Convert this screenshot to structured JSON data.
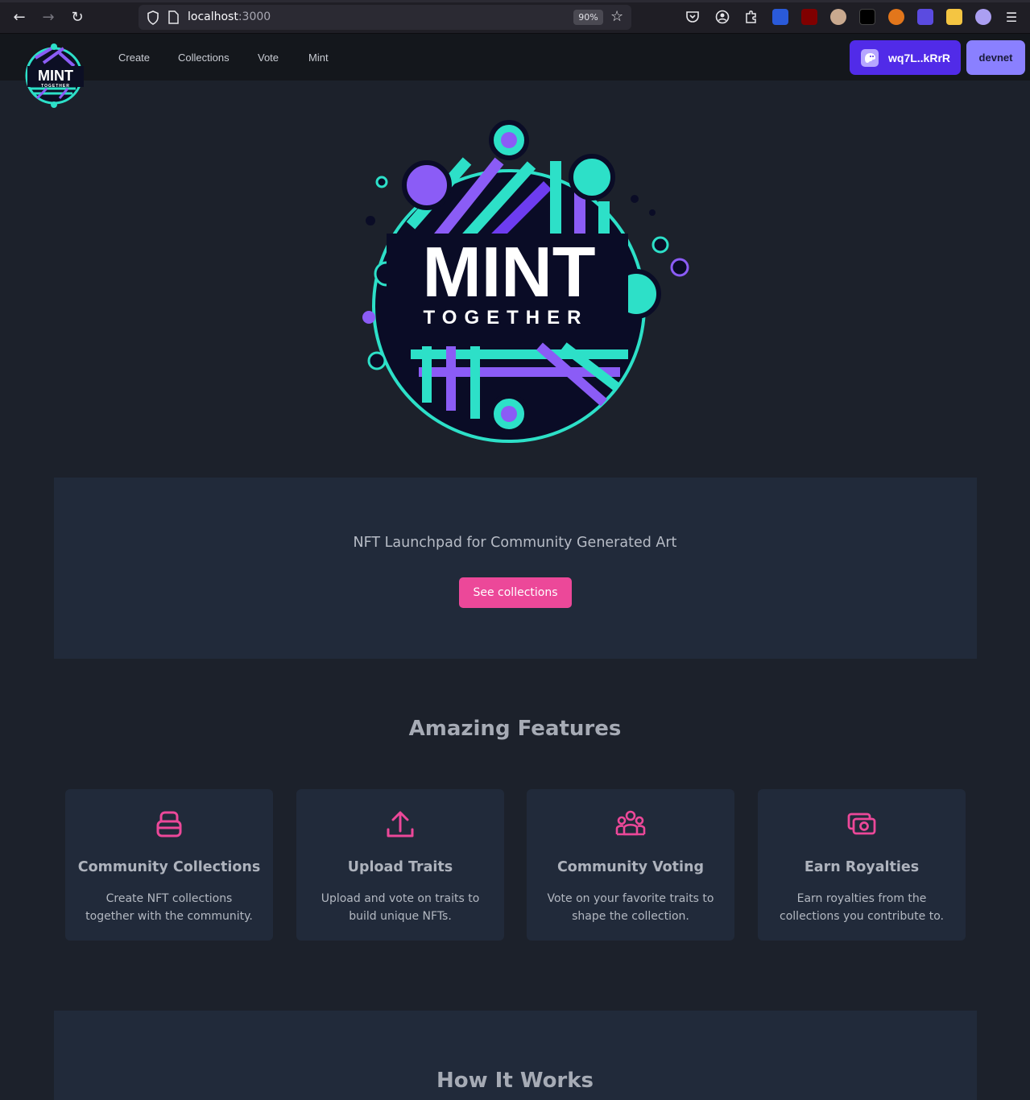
{
  "browser": {
    "url_host": "localhost",
    "url_port": ":3000",
    "zoom": "90%"
  },
  "header": {
    "nav": [
      "Create",
      "Collections",
      "Vote",
      "Mint"
    ],
    "wallet_label": "wq7L..kRrR",
    "network_label": "devnet"
  },
  "logo": {
    "line1": "MINT",
    "line2": "TOGETHER"
  },
  "hero": {
    "tagline": "NFT Launchpad for Community Generated Art",
    "cta_label": "See collections"
  },
  "features": {
    "title": "Amazing Features",
    "items": [
      {
        "icon": "box-icon",
        "title": "Community Collections",
        "desc": "Create NFT collections together with the community."
      },
      {
        "icon": "upload-icon",
        "title": "Upload Traits",
        "desc": "Upload and vote on traits to build unique NFTs."
      },
      {
        "icon": "user-group-icon",
        "title": "Community Voting",
        "desc": "Vote on your favorite traits to shape the collection."
      },
      {
        "icon": "money-icon",
        "title": "Earn Royalties",
        "desc": "Earn royalties from the collections you contribute to."
      }
    ]
  },
  "how": {
    "title": "How It Works"
  },
  "colors": {
    "accent": "#ec4899",
    "wallet": "#512be8",
    "network": "#8a80ff",
    "panel": "#212a3a",
    "bg": "#1c212b"
  }
}
